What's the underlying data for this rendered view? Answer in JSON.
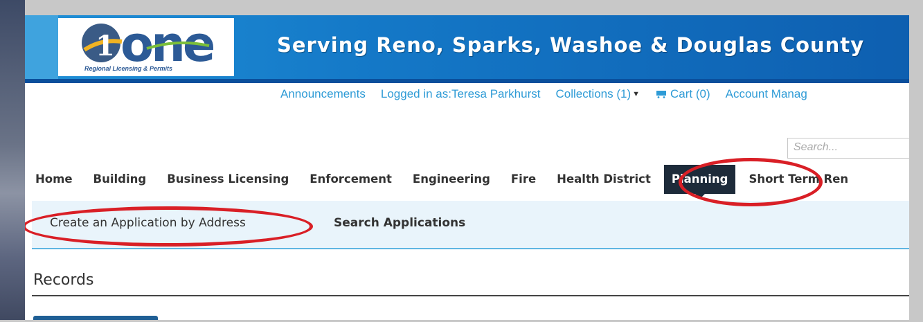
{
  "banner": {
    "logo_word": "one",
    "logo_numeral": "1",
    "logo_subtitle": "Regional Licensing & Permits",
    "tagline": "Serving Reno, Sparks, Washoe & Douglas County"
  },
  "utility_links": {
    "announcements": "Announcements",
    "logged_in": "Logged in as:Teresa Parkhurst",
    "collections": "Collections (1)",
    "cart": "Cart (0)",
    "account": "Account Manag"
  },
  "search": {
    "placeholder": "Search..."
  },
  "main_nav": {
    "items": [
      "Home",
      "Building",
      "Business Licensing",
      "Enforcement",
      "Engineering",
      "Fire",
      "Health District",
      "Planning",
      "Short Term Ren"
    ],
    "active": "Planning"
  },
  "sub_nav": {
    "create_by_address": "Create an Application by Address",
    "search_applications": "Search Applications"
  },
  "section": {
    "title": "Records"
  },
  "colors": {
    "banner_blue": "#1478c7",
    "link_blue": "#2e9bd6",
    "active_nav": "#1d2b3a",
    "subnav_bg": "#e9f4fb",
    "annotation_red": "#d91f26"
  }
}
